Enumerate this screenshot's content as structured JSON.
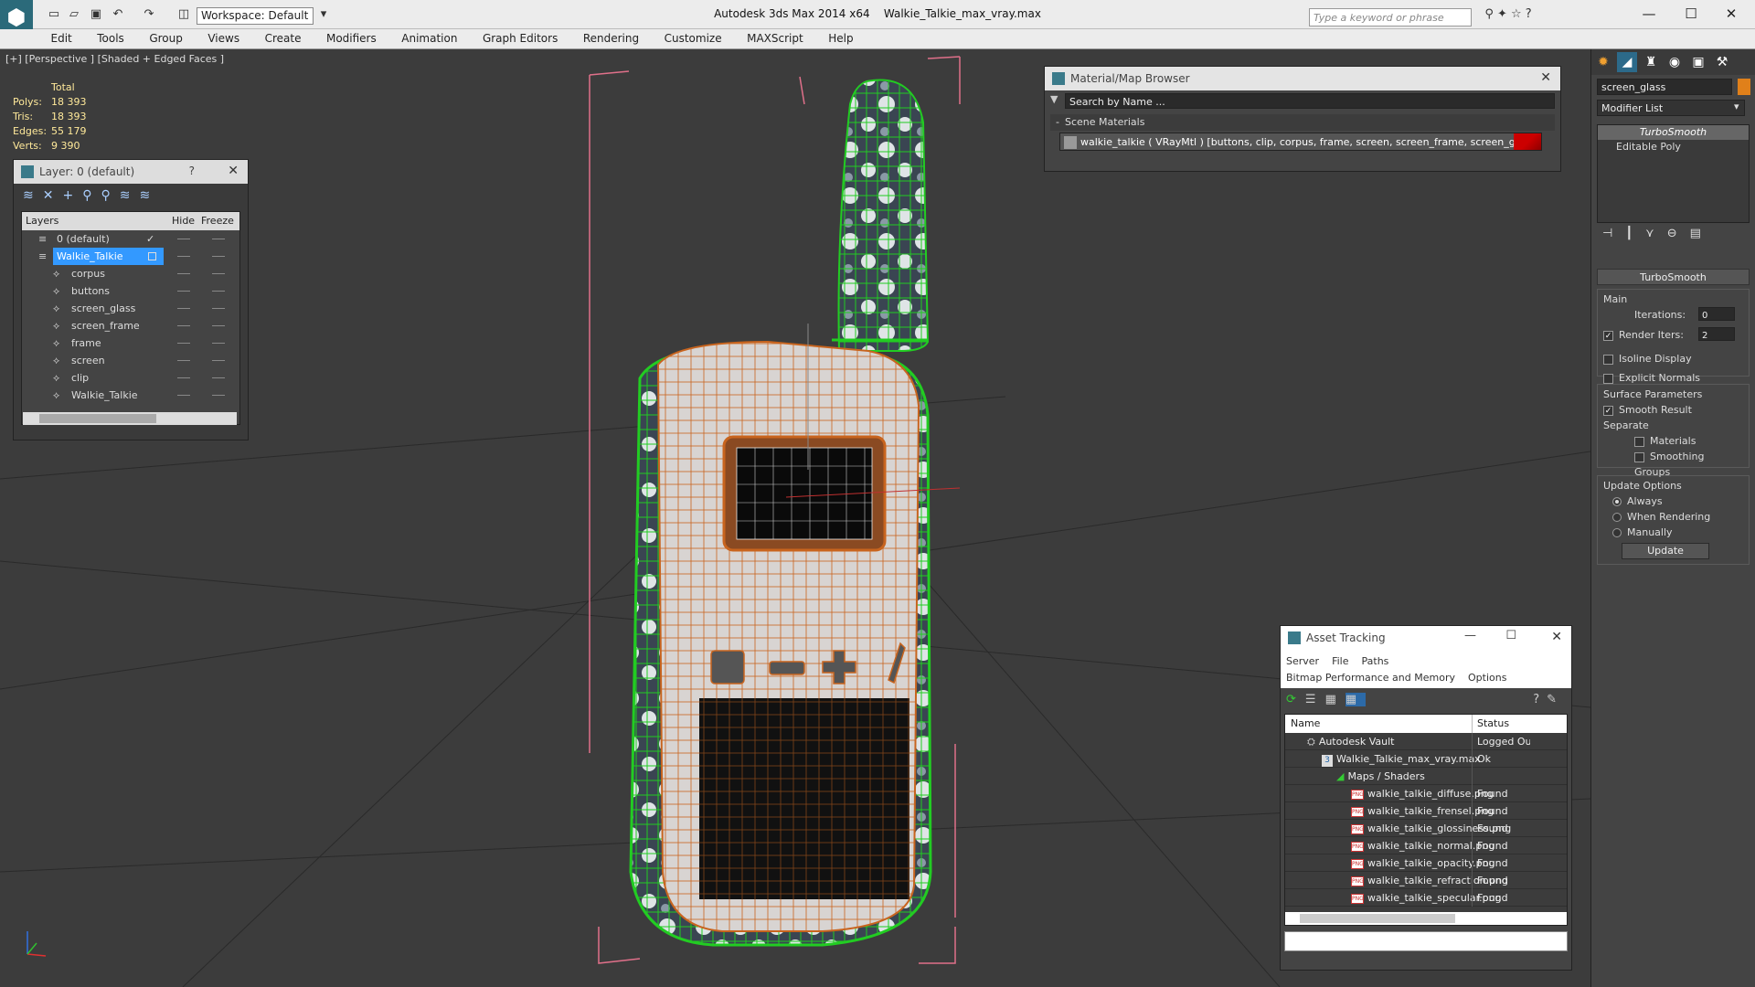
{
  "app": {
    "title": "Autodesk 3ds Max  2014 x64",
    "file": "Walkie_Talkie_max_vray.max",
    "workspace": "Workspace: Default",
    "search_placeholder": "Type a keyword or phrase"
  },
  "menu": [
    "Edit",
    "Tools",
    "Group",
    "Views",
    "Create",
    "Modifiers",
    "Animation",
    "Graph Editors",
    "Rendering",
    "Customize",
    "MAXScript",
    "Help"
  ],
  "viewport": {
    "label": "[+] [Perspective ] [Shaded + Edged Faces ]"
  },
  "stats": {
    "header": "Total",
    "rows": [
      {
        "k": "Polys:",
        "v": "18 393"
      },
      {
        "k": "Tris:",
        "v": "18 393"
      },
      {
        "k": "Edges:",
        "v": "55 179"
      },
      {
        "k": "Verts:",
        "v": "9 390"
      }
    ]
  },
  "layer_panel": {
    "title": "Layer: 0 (default)",
    "help": "?",
    "col_layers": "Layers",
    "col_hide": "Hide",
    "col_freeze": "Freeze",
    "layers": [
      {
        "name": "0 (default)",
        "level": 0
      },
      {
        "name": "Walkie_Talkie",
        "level": 0
      },
      {
        "name": "corpus",
        "level": 1
      },
      {
        "name": "buttons",
        "level": 1
      },
      {
        "name": "screen_glass",
        "level": 1
      },
      {
        "name": "screen_frame",
        "level": 1
      },
      {
        "name": "frame",
        "level": 1
      },
      {
        "name": "screen",
        "level": 1
      },
      {
        "name": "clip",
        "level": 1
      },
      {
        "name": "Walkie_Talkie",
        "level": 1
      }
    ]
  },
  "material_browser": {
    "title": "Material/Map Browser",
    "search": "Search by Name ...",
    "section": "Scene Materials",
    "item": "walkie_talkie  ( VRayMtl ) [buttons, clip, corpus, frame, screen, screen_frame, screen_glass]"
  },
  "command_panel": {
    "object_name": "screen_glass",
    "modifier_list": "Modifier List",
    "stack": [
      "TurboSmooth",
      "Editable Poly"
    ],
    "rollout": "TurboSmooth",
    "main": "Main",
    "iterations_label": "Iterations:",
    "iterations": "0",
    "render_iters_label": "Render Iters:",
    "render_iters": "2",
    "isoline": "Isoline Display",
    "explicit": "Explicit Normals",
    "surface": "Surface Parameters",
    "smooth_result": "Smooth Result",
    "separate": "Separate",
    "materials": "Materials",
    "smoothing_groups": "Smoothing Groups",
    "update_options": "Update Options",
    "always": "Always",
    "when_rendering": "When Rendering",
    "manually": "Manually",
    "update": "Update"
  },
  "asset_tracking": {
    "title": "Asset Tracking",
    "menu": [
      "Server",
      "File",
      "Paths"
    ],
    "menu2": [
      "Bitmap Performance and Memory",
      "Options"
    ],
    "col_name": "Name",
    "col_status": "Status",
    "rows": [
      {
        "name": "Autodesk Vault",
        "status": "Logged Ou",
        "level": 1,
        "icon": "vault"
      },
      {
        "name": "Walkie_Talkie_max_vray.max",
        "status": "Ok",
        "level": 2,
        "icon": "max"
      },
      {
        "name": "Maps / Shaders",
        "status": "",
        "level": 3,
        "icon": "maps"
      },
      {
        "name": "walkie_talkie_diffuse.png",
        "status": "Found",
        "level": 4,
        "icon": "png"
      },
      {
        "name": "walkie_talkie_frensel.png",
        "status": "Found",
        "level": 4,
        "icon": "png"
      },
      {
        "name": "walkie_talkie_glossiness.png",
        "status": "Found",
        "level": 4,
        "icon": "png"
      },
      {
        "name": "walkie_talkie_normal.png",
        "status": "Found",
        "level": 4,
        "icon": "png"
      },
      {
        "name": "walkie_talkie_opacity.png",
        "status": "Found",
        "level": 4,
        "icon": "png"
      },
      {
        "name": "walkie_talkie_refraction.png",
        "status": "Found",
        "level": 4,
        "icon": "png"
      },
      {
        "name": "walkie_talkie_specular.png",
        "status": "Found",
        "level": 4,
        "icon": "png"
      }
    ]
  },
  "colors": {
    "accent": "#3399ff",
    "wire_orange": "#c8641e",
    "wire_green": "#22cc22",
    "bbox_pink": "#e0708a",
    "swatch": "#e0801a"
  }
}
